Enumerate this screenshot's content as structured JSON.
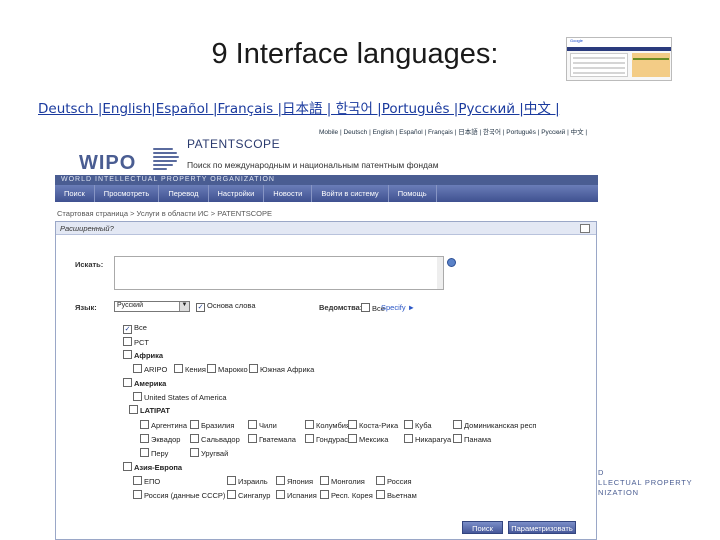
{
  "slide": {
    "title": "9 Interface languages:",
    "languages_line": "Deutsch |English|Español |Français |日本語 | 한국어 |Português |Русский |中文 |"
  },
  "thumbnail": {
    "label": "Google"
  },
  "screenshot": {
    "lang_bar": "Mobile | Deutsch | English | Español | Français | 日本語 | 한국어 | Português | Русский | 中文 |",
    "logo_text": "WIPO",
    "product_title": "PATENTSCOPE",
    "product_subtitle": "Поиск по международным и национальным патентным фондам",
    "org_name": "WORLD INTELLECTUAL PROPERTY ORGANIZATION",
    "nav": [
      "Поиск",
      "Просмотреть",
      "Перевод",
      "Настройки",
      "Новости",
      "Войти в систему",
      "Помощь"
    ],
    "breadcrumb": "Стартовая страница > Услуги в области ИС > PATENTSCOPE",
    "panel_title": "Расширенный?",
    "search_label": "Искать:",
    "language_label": "Язык:",
    "language_value": "Русский",
    "stemming_label": "Основа слова",
    "offices_label": "Ведомства:",
    "offices_all": "Все",
    "offices_specify": "Specify ►",
    "offices": {
      "all": "Все",
      "pct": "PCT",
      "africa": "Африка",
      "africa_items": [
        "ARIPO",
        "Кения",
        "Марокко",
        "Южная Африка"
      ],
      "america": "Америка",
      "usa": "United States of America",
      "latam": "LATIPAT",
      "latam_row1": [
        "Аргентина",
        "Бразилия",
        "Чили",
        "Колумбия",
        "Коста-Рика",
        "Куба",
        "Доминиканская респ"
      ],
      "latam_row2": [
        "Эквадор",
        "Сальвадор",
        "Гватемала",
        "Гондурас",
        "Мексика",
        "Никарагуа",
        "Панама"
      ],
      "latam_row3": [
        "Перу",
        "Уругвай"
      ],
      "asia_europe": "Азия-Европа",
      "asia_row1": [
        "ЕПО",
        "Израиль",
        "Япония",
        "Монголия",
        "Россия"
      ],
      "asia_row2": [
        "Россия (данные СССР)",
        "Сингапур",
        "Испания",
        "Респ. Корея",
        "Вьетнам"
      ]
    },
    "buttons": {
      "search": "Поиск",
      "parameters": "Параметризовать"
    }
  },
  "side_logo": {
    "line1": "D",
    "line2": "LLECTUAL PROPERTY",
    "line3": "NIZATION"
  },
  "colors": {
    "brand": "#4a5d92",
    "link": "#1a3a9e"
  }
}
